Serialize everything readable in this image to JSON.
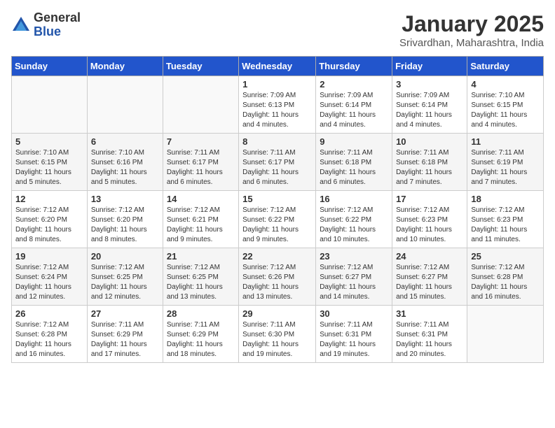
{
  "header": {
    "logo_general": "General",
    "logo_blue": "Blue",
    "month_title": "January 2025",
    "location": "Srivardhan, Maharashtra, India"
  },
  "days_of_week": [
    "Sunday",
    "Monday",
    "Tuesday",
    "Wednesday",
    "Thursday",
    "Friday",
    "Saturday"
  ],
  "weeks": [
    [
      {
        "day": "",
        "info": ""
      },
      {
        "day": "",
        "info": ""
      },
      {
        "day": "",
        "info": ""
      },
      {
        "day": "1",
        "info": "Sunrise: 7:09 AM\nSunset: 6:13 PM\nDaylight: 11 hours and 4 minutes."
      },
      {
        "day": "2",
        "info": "Sunrise: 7:09 AM\nSunset: 6:14 PM\nDaylight: 11 hours and 4 minutes."
      },
      {
        "day": "3",
        "info": "Sunrise: 7:09 AM\nSunset: 6:14 PM\nDaylight: 11 hours and 4 minutes."
      },
      {
        "day": "4",
        "info": "Sunrise: 7:10 AM\nSunset: 6:15 PM\nDaylight: 11 hours and 4 minutes."
      }
    ],
    [
      {
        "day": "5",
        "info": "Sunrise: 7:10 AM\nSunset: 6:15 PM\nDaylight: 11 hours and 5 minutes."
      },
      {
        "day": "6",
        "info": "Sunrise: 7:10 AM\nSunset: 6:16 PM\nDaylight: 11 hours and 5 minutes."
      },
      {
        "day": "7",
        "info": "Sunrise: 7:11 AM\nSunset: 6:17 PM\nDaylight: 11 hours and 6 minutes."
      },
      {
        "day": "8",
        "info": "Sunrise: 7:11 AM\nSunset: 6:17 PM\nDaylight: 11 hours and 6 minutes."
      },
      {
        "day": "9",
        "info": "Sunrise: 7:11 AM\nSunset: 6:18 PM\nDaylight: 11 hours and 6 minutes."
      },
      {
        "day": "10",
        "info": "Sunrise: 7:11 AM\nSunset: 6:18 PM\nDaylight: 11 hours and 7 minutes."
      },
      {
        "day": "11",
        "info": "Sunrise: 7:11 AM\nSunset: 6:19 PM\nDaylight: 11 hours and 7 minutes."
      }
    ],
    [
      {
        "day": "12",
        "info": "Sunrise: 7:12 AM\nSunset: 6:20 PM\nDaylight: 11 hours and 8 minutes."
      },
      {
        "day": "13",
        "info": "Sunrise: 7:12 AM\nSunset: 6:20 PM\nDaylight: 11 hours and 8 minutes."
      },
      {
        "day": "14",
        "info": "Sunrise: 7:12 AM\nSunset: 6:21 PM\nDaylight: 11 hours and 9 minutes."
      },
      {
        "day": "15",
        "info": "Sunrise: 7:12 AM\nSunset: 6:22 PM\nDaylight: 11 hours and 9 minutes."
      },
      {
        "day": "16",
        "info": "Sunrise: 7:12 AM\nSunset: 6:22 PM\nDaylight: 11 hours and 10 minutes."
      },
      {
        "day": "17",
        "info": "Sunrise: 7:12 AM\nSunset: 6:23 PM\nDaylight: 11 hours and 10 minutes."
      },
      {
        "day": "18",
        "info": "Sunrise: 7:12 AM\nSunset: 6:23 PM\nDaylight: 11 hours and 11 minutes."
      }
    ],
    [
      {
        "day": "19",
        "info": "Sunrise: 7:12 AM\nSunset: 6:24 PM\nDaylight: 11 hours and 12 minutes."
      },
      {
        "day": "20",
        "info": "Sunrise: 7:12 AM\nSunset: 6:25 PM\nDaylight: 11 hours and 12 minutes."
      },
      {
        "day": "21",
        "info": "Sunrise: 7:12 AM\nSunset: 6:25 PM\nDaylight: 11 hours and 13 minutes."
      },
      {
        "day": "22",
        "info": "Sunrise: 7:12 AM\nSunset: 6:26 PM\nDaylight: 11 hours and 13 minutes."
      },
      {
        "day": "23",
        "info": "Sunrise: 7:12 AM\nSunset: 6:27 PM\nDaylight: 11 hours and 14 minutes."
      },
      {
        "day": "24",
        "info": "Sunrise: 7:12 AM\nSunset: 6:27 PM\nDaylight: 11 hours and 15 minutes."
      },
      {
        "day": "25",
        "info": "Sunrise: 7:12 AM\nSunset: 6:28 PM\nDaylight: 11 hours and 16 minutes."
      }
    ],
    [
      {
        "day": "26",
        "info": "Sunrise: 7:12 AM\nSunset: 6:28 PM\nDaylight: 11 hours and 16 minutes."
      },
      {
        "day": "27",
        "info": "Sunrise: 7:11 AM\nSunset: 6:29 PM\nDaylight: 11 hours and 17 minutes."
      },
      {
        "day": "28",
        "info": "Sunrise: 7:11 AM\nSunset: 6:29 PM\nDaylight: 11 hours and 18 minutes."
      },
      {
        "day": "29",
        "info": "Sunrise: 7:11 AM\nSunset: 6:30 PM\nDaylight: 11 hours and 19 minutes."
      },
      {
        "day": "30",
        "info": "Sunrise: 7:11 AM\nSunset: 6:31 PM\nDaylight: 11 hours and 19 minutes."
      },
      {
        "day": "31",
        "info": "Sunrise: 7:11 AM\nSunset: 6:31 PM\nDaylight: 11 hours and 20 minutes."
      },
      {
        "day": "",
        "info": ""
      }
    ]
  ]
}
